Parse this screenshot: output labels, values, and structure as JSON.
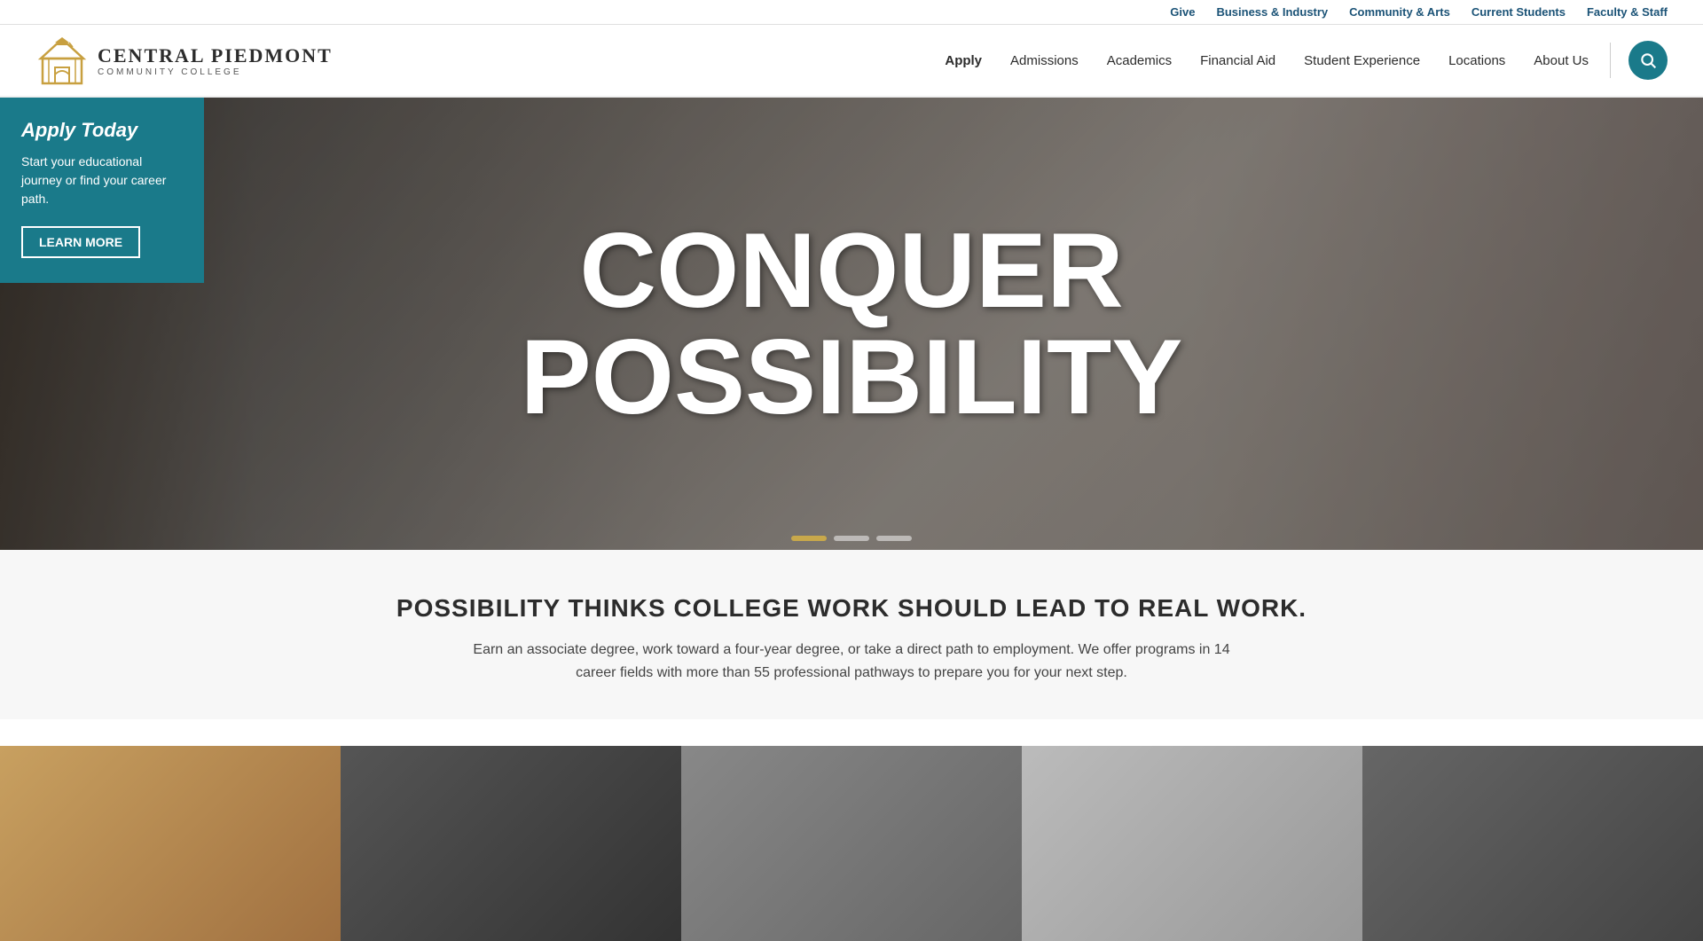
{
  "site": {
    "name": "Central Piedmont",
    "subtitle": "Community College",
    "logo_alt": "Central Piedmont Community College Logo"
  },
  "topbar": {
    "links": [
      {
        "id": "give",
        "label": "Give"
      },
      {
        "id": "business-industry",
        "label": "Business & Industry"
      },
      {
        "id": "community-arts",
        "label": "Community & Arts"
      },
      {
        "id": "current-students",
        "label": "Current Students"
      },
      {
        "id": "faculty-staff",
        "label": "Faculty & Staff"
      }
    ]
  },
  "mainnav": {
    "links": [
      {
        "id": "apply",
        "label": "Apply"
      },
      {
        "id": "admissions",
        "label": "Admissions"
      },
      {
        "id": "academics",
        "label": "Academics"
      },
      {
        "id": "financial-aid",
        "label": "Financial Aid"
      },
      {
        "id": "student-experience",
        "label": "Student Experience"
      },
      {
        "id": "locations",
        "label": "Locations"
      },
      {
        "id": "about-us",
        "label": "About Us"
      }
    ],
    "search_aria": "Search"
  },
  "hero": {
    "apply_today": {
      "heading": "Apply Today",
      "body": "Start your educational journey or find your career path.",
      "cta": "Learn More"
    },
    "headline_line1": "CONQUER",
    "headline_line2": "POSSIBILITY",
    "carousel_dots": [
      {
        "active": true
      },
      {
        "active": false
      },
      {
        "active": false
      }
    ]
  },
  "possibility_section": {
    "heading": "POSSIBILITY THINKS COLLEGE WORK SHOULD LEAD TO REAL WORK.",
    "body": "Earn an associate degree, work toward a four-year degree, or take a direct path to employment. We offer programs in 14 career fields with more than 55 professional pathways to prepare you for your next step."
  }
}
